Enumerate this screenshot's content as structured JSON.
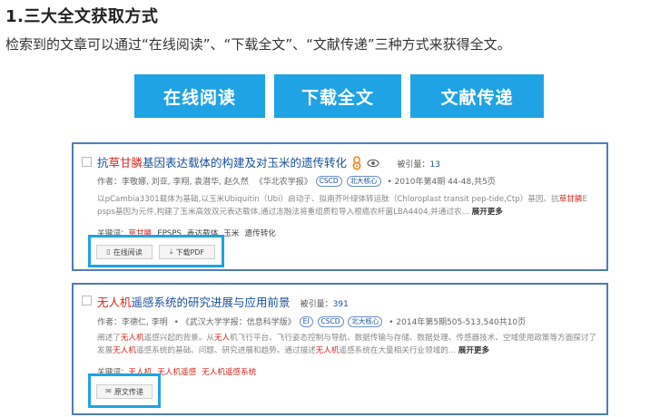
{
  "heading": "1.三大全文获取方式",
  "intro": "检索到的文章可以通过“在线阅读”、“下载全文”、“文献传递”三种方式来获得全文。",
  "methods": [
    "在线阅读",
    "下载全文",
    "文献传递"
  ],
  "article1": {
    "title_pre": "抗",
    "title_hl": "草甘膦",
    "title_post": "基因表达载体的构建及对玉米的遗传转化",
    "cited_label": "被引量：",
    "cited_value": "13",
    "authors_label": "作者：",
    "authors": "李敬娜, 刘亚, 李翔, 袁潜华, 赵久然",
    "journal": "《华北农学报》",
    "tags": [
      "CSCD",
      "北大核心"
    ],
    "issue": "• 2010年第4期 44-48,共5页",
    "abstract_a": "以pCambia3301载体为基础,以玉米Ubiquitin（Ubi）启动子、拟南芥叶绿体转运肽（Chloroplast transit pep-tide,Ctp）基因、抗",
    "abstract_hl": "草甘膦",
    "abstract_b": "E psps基因为元件,构建了玉米高效双元表达载体,通过冻融法将重组质粒导入根癌农杆菌LBA4404,并通过农...",
    "more": "展开更多",
    "keywords_label": "关键词：",
    "keywords": [
      "草甘膦",
      "EPSPS",
      "表达载体",
      "玉米",
      "遗传转化"
    ],
    "actions": [
      {
        "icon": "book-icon",
        "label": "在线阅读"
      },
      {
        "icon": "download-icon",
        "label": "下载PDF"
      }
    ]
  },
  "article2": {
    "title_hl": "无人机",
    "title_post": "遥感系统的研究进展与应用前景",
    "cited_label": "被引量：",
    "cited_value": "391",
    "authors_label": "作者：",
    "authors": "李德仁, 李明",
    "journal": "• 《武汉大学学报：信息科学版》",
    "tags": [
      "EI",
      "CSCD",
      "北大核心"
    ],
    "issue": "• 2014年第5期505-513,540共10页",
    "abstract_1a": "阐述了",
    "abstract_1hl": "无人机",
    "abstract_1b": "遥感兴起的背景。从",
    "abstract_1hl2": "无人",
    "abstract_1c": "机飞行平台、飞行姿态控制与导航、数据传输与存储、数据处理、传感器技术、空域使用政策等方面探讨",
    "abstract_2a": "了发展",
    "abstract_2hl": "无人机",
    "abstract_2b": "遥感系统的基础、问题、研究进展和趋势。通过描述",
    "abstract_2hl2": "无人机",
    "abstract_2c": "遥感系统在大量相关行业领域的...",
    "more": "展开更多",
    "keywords_label": "关键词：",
    "keywords": [
      "无人机",
      "无人机遥感",
      "无人机遥感系统"
    ],
    "actions": [
      {
        "icon": "mail-icon",
        "label": "原文传递"
      }
    ]
  }
}
